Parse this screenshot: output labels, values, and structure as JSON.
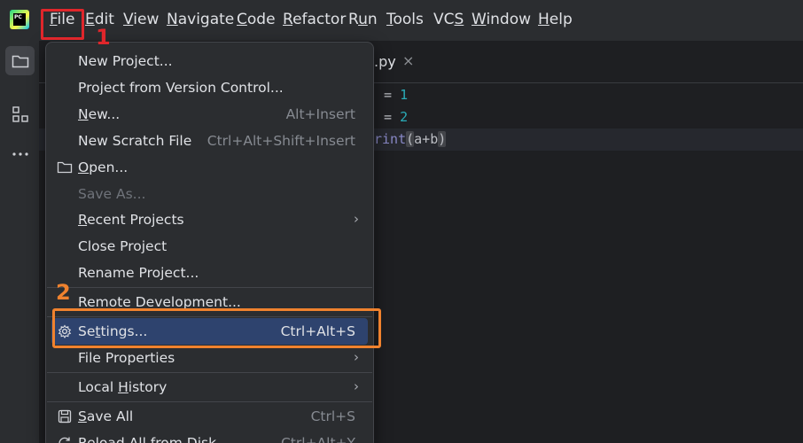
{
  "app": {
    "logo_text": "PC"
  },
  "menubar": {
    "items": [
      {
        "pre": "",
        "ul": "F",
        "post": "ile"
      },
      {
        "pre": "",
        "ul": "E",
        "post": "dit"
      },
      {
        "pre": "",
        "ul": "V",
        "post": "iew"
      },
      {
        "pre": "",
        "ul": "N",
        "post": "avigate"
      },
      {
        "pre": "",
        "ul": "C",
        "post": "ode"
      },
      {
        "pre": "",
        "ul": "R",
        "post": "efactor"
      },
      {
        "pre": "R",
        "ul": "u",
        "post": "n"
      },
      {
        "pre": "",
        "ul": "T",
        "post": "ools"
      },
      {
        "pre": "VC",
        "ul": "S",
        "post": ""
      },
      {
        "pre": "",
        "ul": "W",
        "post": "indow"
      },
      {
        "pre": "",
        "ul": "H",
        "post": "elp"
      }
    ]
  },
  "toolstrip": {
    "icons": [
      "folder-icon",
      "structure-icon",
      "more-icon"
    ]
  },
  "editor": {
    "tab": {
      "label": ".py",
      "close": "×"
    },
    "lines": [
      {
        "op": "= ",
        "num": "1"
      },
      {
        "op": "= ",
        "num": "2"
      },
      {
        "fn": "rint",
        "open": "(",
        "args": "a+b",
        "close": ")"
      }
    ]
  },
  "file_menu": {
    "items": [
      {
        "pre": "New Project...",
        "ul": "",
        "post": "",
        "shortcut": ""
      },
      {
        "pre": "Project from Version Control...",
        "ul": "",
        "post": "",
        "shortcut": ""
      },
      {
        "pre": "",
        "ul": "N",
        "post": "ew...",
        "shortcut": "Alt+Insert"
      },
      {
        "pre": "New Scratch File",
        "ul": "",
        "post": "",
        "shortcut": "Ctrl+Alt+Shift+Insert"
      },
      {
        "pre": "",
        "ul": "O",
        "post": "pen...",
        "shortcut": ""
      },
      {
        "pre": "Save As...",
        "ul": "",
        "post": "",
        "shortcut": ""
      },
      {
        "pre": "",
        "ul": "R",
        "post": "ecent Projects",
        "shortcut": ""
      },
      {
        "pre": "Close Project",
        "ul": "",
        "post": "",
        "shortcut": ""
      },
      {
        "pre": "Rename Project...",
        "ul": "",
        "post": "",
        "shortcut": ""
      },
      {
        "pre": "Remote Development...",
        "ul": "",
        "post": "",
        "shortcut": ""
      },
      {
        "pre": "Se",
        "ul": "t",
        "post": "tings...",
        "shortcut": "Ctrl+Alt+S"
      },
      {
        "pre": "File Properties",
        "ul": "",
        "post": "",
        "shortcut": ""
      },
      {
        "pre": "Local ",
        "ul": "H",
        "post": "istory",
        "shortcut": ""
      },
      {
        "pre": "",
        "ul": "S",
        "post": "ave All",
        "shortcut": "Ctrl+S"
      },
      {
        "pre": "Reload All from Disk",
        "ul": "",
        "post": "",
        "shortcut": "Ctrl+Alt+Y"
      }
    ],
    "submenu_arrow": "›"
  },
  "annotations": {
    "step1": "1",
    "step2": "2",
    "colors": {
      "step1": "#e0262b",
      "step2": "#f0822e"
    }
  },
  "colors": {
    "menu_bg": "#2b2d30",
    "editor_bg": "#1e1f22",
    "selection": "#2e436e",
    "number": "#2aacb8"
  }
}
